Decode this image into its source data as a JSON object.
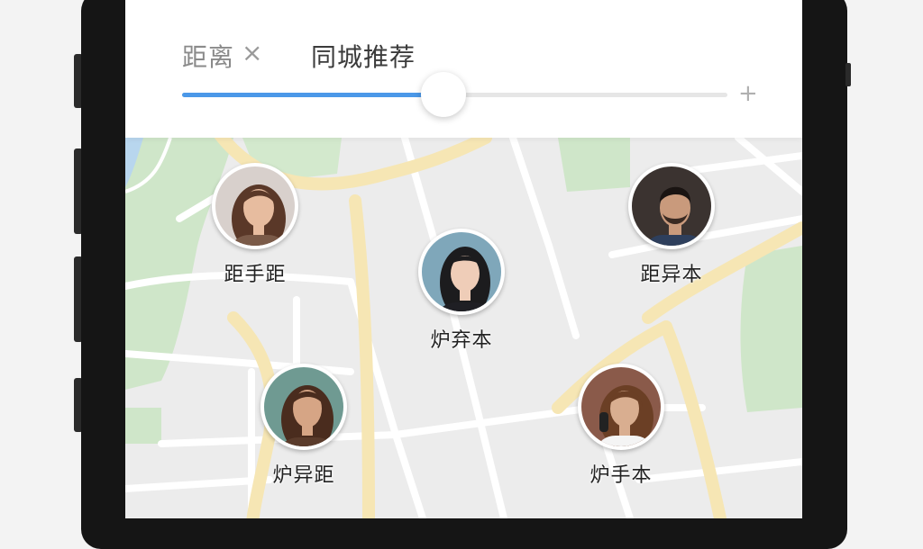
{
  "filter_bar": {
    "distance_tab": "距离",
    "close_symbol": "×",
    "local_tab": "同城推荐",
    "plus_symbol": "+",
    "radius_slider_fraction": 0.48
  },
  "users": [
    {
      "name": "距手距",
      "avatar_bg": "#d8d0cc",
      "hair": "#5a3828",
      "skin": "#e7bc9f",
      "shirt": "#7a5a48"
    },
    {
      "name": "炉弃本",
      "avatar_bg": "#7fa7ba",
      "hair": "#1c1c1e",
      "skin": "#efcdb8",
      "shirt": "#1f1f24"
    },
    {
      "name": "距异本",
      "avatar_bg": "#3b3330",
      "hair": "#1a1412",
      "skin": "#c99a7c",
      "shirt": "#2e3f5c"
    },
    {
      "name": "炉异距",
      "avatar_bg": "#6f9a92",
      "hair": "#4a2c1e",
      "skin": "#d6a585",
      "shirt": "#5a3b2b"
    },
    {
      "name": "炉手本",
      "avatar_bg": "#8a5a4a",
      "hair": "#6b3f25",
      "skin": "#d9ae90",
      "shirt": "#f4f4f4"
    }
  ],
  "colors": {
    "accent": "#4b98e8",
    "map_bg": "#ececec",
    "park": "#c8e3c2",
    "main_road": "#f7e7b6",
    "water": "#b8d6ee"
  }
}
